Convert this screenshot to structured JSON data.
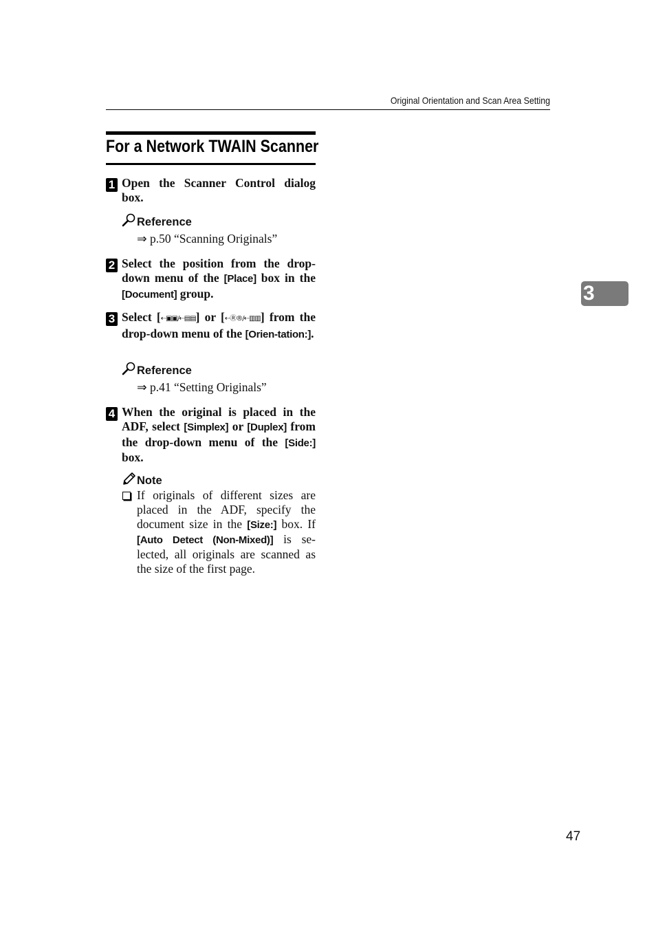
{
  "running_header": "Original Orientation and Scan Area Setting",
  "section_title": "For a Network TWAIN Scanner",
  "steps": [
    {
      "number": "1",
      "text": "Open the Scanner Control dialog box."
    },
    {
      "number": "2",
      "parts": {
        "a": "Select the position from the drop-down menu of the ",
        "kw1": "[Place]",
        "b": " box in the ",
        "kw2": "[Document]",
        "c": " group."
      }
    },
    {
      "number": "3",
      "parts": {
        "a": "Select [",
        "icon1": "⇠▣▣/⇠▤▤",
        "b": "] or [",
        "icon2": "⇠Ⓡ®/⇠▥▥",
        "c": "] from the drop-down menu of the ",
        "kw1": "[Orien-tation:]",
        "d": "."
      }
    },
    {
      "number": "4",
      "parts": {
        "a": "When the original is placed in the ADF, select ",
        "kw1": "[Simplex]",
        "b": " or ",
        "kw2": "[Duplex]",
        "c": " from the drop-down menu of the ",
        "kw3": "[Side:]",
        "d": " box."
      }
    }
  ],
  "references": [
    {
      "label": "Reference",
      "icon": "magnifier-icon",
      "link": "⇒ p.50 “Scanning Originals”"
    },
    {
      "label": "Reference",
      "icon": "magnifier-icon",
      "link": "⇒ p.41 “Setting Originals”"
    }
  ],
  "note": {
    "label": "Note",
    "icon": "pencil-icon",
    "item": {
      "a": "If originals of different sizes are placed in the ADF, specify the document size in the ",
      "kw1": "[Size:]",
      "b": " box. If ",
      "kw2": "[Auto Detect (Non-Mixed)]",
      "c": " is se-lected, all originals are scanned as the size of the first page."
    }
  },
  "chapter_tab": "3",
  "page_number": "47"
}
